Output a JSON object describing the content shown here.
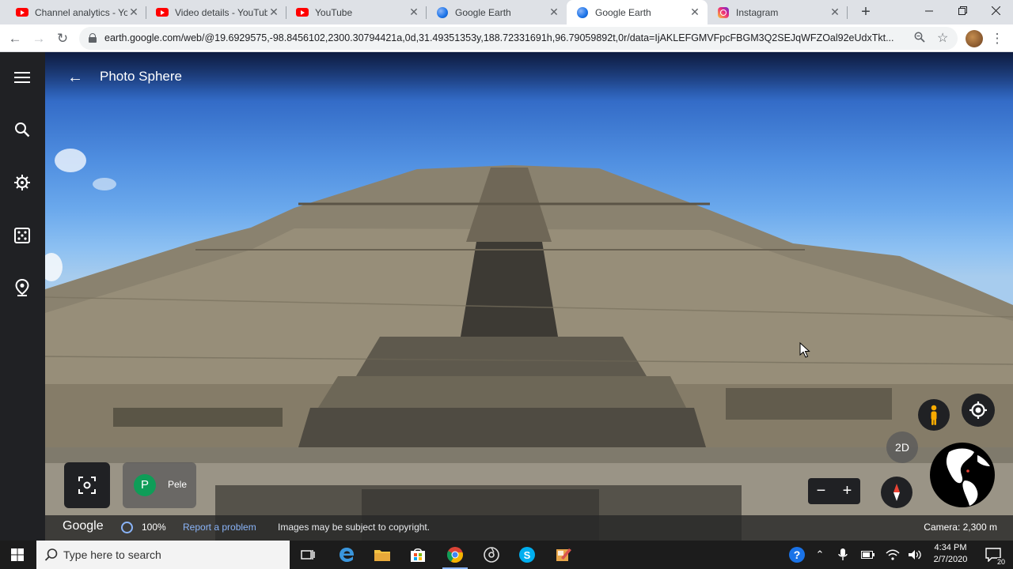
{
  "browser": {
    "tabs": [
      {
        "title": "Channel analytics - You",
        "icon": "youtube-icon"
      },
      {
        "title": "Video details - YouTube",
        "icon": "youtube-icon"
      },
      {
        "title": "YouTube",
        "icon": "youtube-icon"
      },
      {
        "title": "Google Earth",
        "icon": "google-earth-icon"
      },
      {
        "title": "Google Earth",
        "icon": "google-earth-icon",
        "active": true
      },
      {
        "title": "Instagram",
        "icon": "instagram-icon"
      }
    ],
    "new_tab_label": "+",
    "url": "earth.google.com/web/@19.6929575,-98.8456102,2300.30794421a,0d,31.49351353y,188.72331691h,96.79059892t,0r/data=IjAKLEFGMVFpcFBGM3Q2SEJqWFZOal92eUdxTkt..."
  },
  "earth": {
    "page_title": "Photo Sphere",
    "user": {
      "initial": "P",
      "name": "Pele"
    },
    "mode_toggle": "2D",
    "bottom": {
      "logo": "Google",
      "loading_pct": "100%",
      "report": "Report a problem",
      "copyright": "Images may be subject to copyright.",
      "camera": "Camera: 2,300 m"
    }
  },
  "taskbar": {
    "search_placeholder": "Type here to search",
    "time": "4:34 PM",
    "date": "2/7/2020",
    "notification_count": "20"
  },
  "colors": {
    "accent": "#1a73e8",
    "earth_dark": "#202124",
    "link": "#8ab4f8",
    "youtube": "#ff0000"
  }
}
